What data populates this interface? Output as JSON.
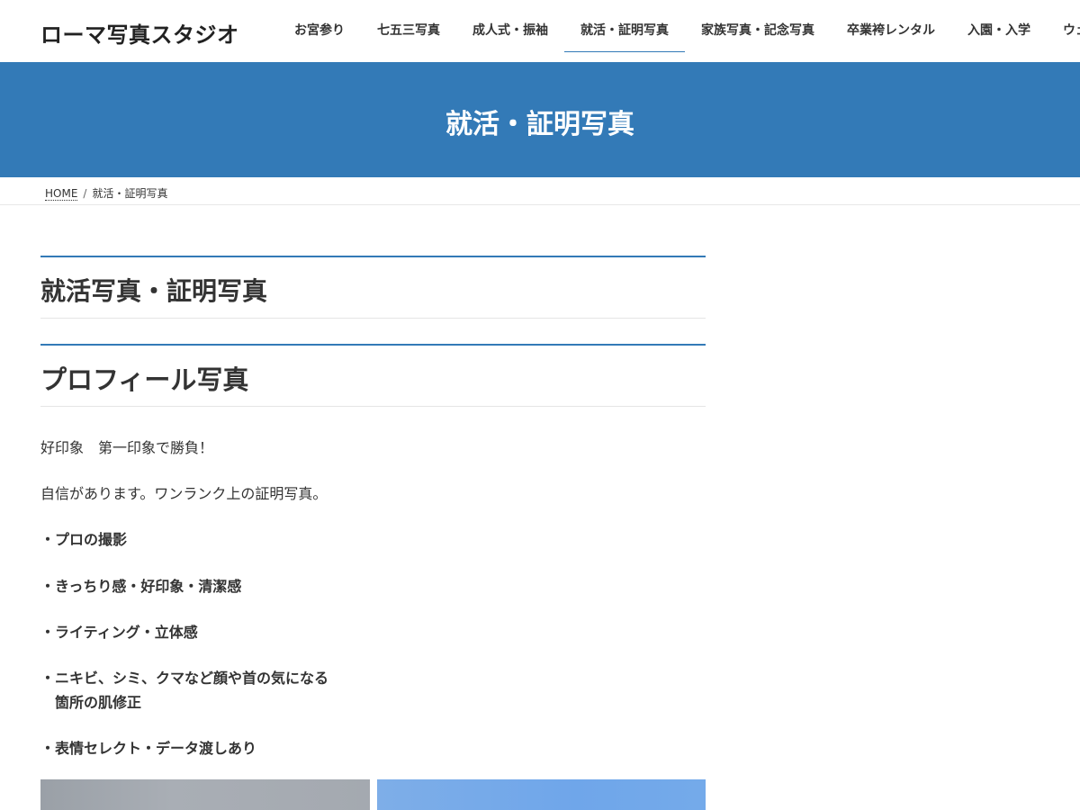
{
  "header": {
    "logo": "ローマ写真スタジオ",
    "nav": [
      "お宮参り",
      "七五三写真",
      "成人式・振袖",
      "就活・証明写真",
      "家族写真・記念写真",
      "卒業袴レンタル",
      "入園・入学",
      "ウェ"
    ],
    "active_index": 3
  },
  "banner": {
    "title": "就活・証明写真"
  },
  "breadcrumb": {
    "home": "HOME",
    "separator": "/",
    "current": "就活・証明写真"
  },
  "content": {
    "heading_1": "就活写真・証明写真",
    "heading_2": "プロフィール写真",
    "intro": [
      "好印象　第一印象で勝負！",
      "自信があります。ワンランク上の証明写真。"
    ],
    "features": [
      "・プロの撮影",
      "・きっちり感・好印象・清潔感",
      "・ライティング・立体感",
      "・ニキビ、シミ、クマなど顔や首の気になる",
      "箇所の肌修正",
      "・表情セレクト・データ渡しあり"
    ]
  },
  "colors": {
    "accent": "#337ab7",
    "text": "#333333",
    "banner_text": "#ffffff"
  }
}
